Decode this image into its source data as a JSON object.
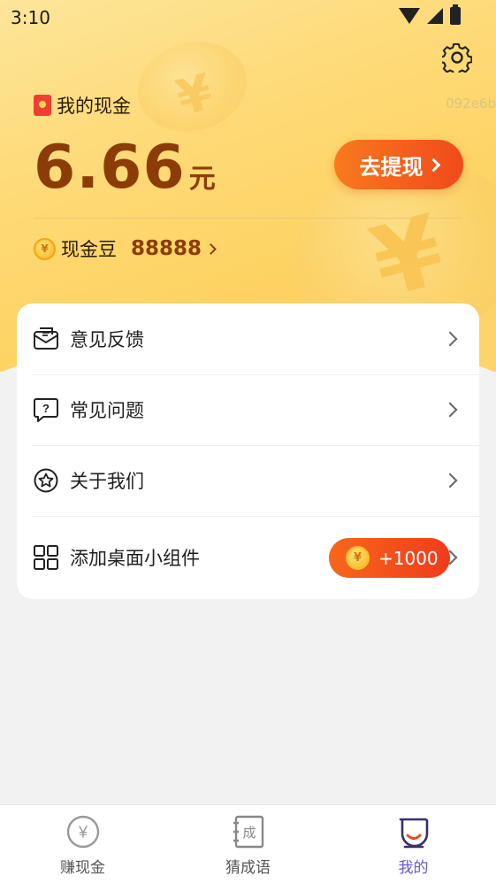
{
  "status_bar": {
    "time": "3:10"
  },
  "header": {
    "user_id": "092e6b",
    "cash_label": "我的现金",
    "cash_value": "6.66",
    "cash_unit": "元",
    "withdraw_label": "去提现",
    "beans_label": "现金豆",
    "beans_value": "88888"
  },
  "menu": {
    "items": [
      {
        "label": "意见反馈",
        "icon": "feedback-icon"
      },
      {
        "label": "常见问题",
        "icon": "faq-icon"
      },
      {
        "label": "关于我们",
        "icon": "about-icon"
      },
      {
        "label": "添加桌面小组件",
        "icon": "widget-grid-icon",
        "reward": "+1000"
      }
    ]
  },
  "bottom_nav": {
    "items": [
      {
        "label": "赚现金",
        "icon": "yen-coin-icon"
      },
      {
        "label": "猜成语",
        "icon": "idiom-book-icon"
      },
      {
        "label": "我的",
        "icon": "profile-icon",
        "active": true
      }
    ]
  },
  "colors": {
    "accent_orange": "#f04a1a",
    "cash_brown": "#8c3d07",
    "active_nav": "#6b57c8",
    "header_yellow": "#fed974"
  }
}
